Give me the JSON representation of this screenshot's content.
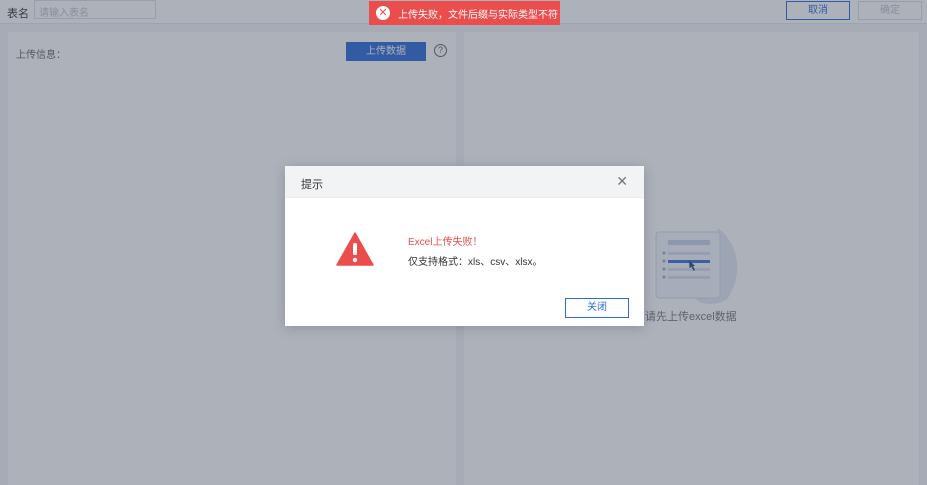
{
  "topbar": {
    "table_name_label": "表名",
    "table_name_placeholder": "请输入表名",
    "cancel_label": "取消",
    "confirm_label": "确定"
  },
  "left_panel": {
    "upload_info_label": "上传信息：",
    "upload_button_label": "上传数据",
    "help_icon": "question-circle-icon"
  },
  "right_panel": {
    "empty_text": "请先上传excel数据",
    "illustration_icon": "document-upload-illustration"
  },
  "toast": {
    "message": "上传失败，文件后缀与实际类型不符",
    "icon": "close-circle-icon",
    "color": "#eb4d4d"
  },
  "dialog": {
    "title": "提示",
    "close_icon": "close-icon",
    "warning_icon": "warning-triangle-icon",
    "error_text": "Excel上传失败！",
    "message": "仅支持格式：xls、csv、xlsx。",
    "close_button_label": "关闭"
  },
  "colors": {
    "primary": "#2d6cd8",
    "danger": "#eb4d4d"
  }
}
